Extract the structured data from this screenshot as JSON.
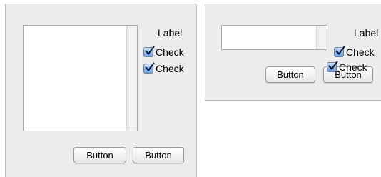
{
  "left_panel": {
    "label": "Label",
    "checkbox_1": {
      "label": "Check",
      "checked": true
    },
    "checkbox_2": {
      "label": "Check",
      "checked": true
    },
    "button_1_label": "Button",
    "button_2_label": "Button"
  },
  "right_panel": {
    "label": "Label",
    "checkbox_1": {
      "label": "Check",
      "checked": true
    },
    "checkbox_2": {
      "label": "Check",
      "checked": true
    },
    "button_1_label": "Button",
    "button_2_label": "Button"
  },
  "colors": {
    "panel_background": "#ececec",
    "checkbox_fill": "#8fb8ee",
    "checkmark": "#0d1b3a"
  }
}
